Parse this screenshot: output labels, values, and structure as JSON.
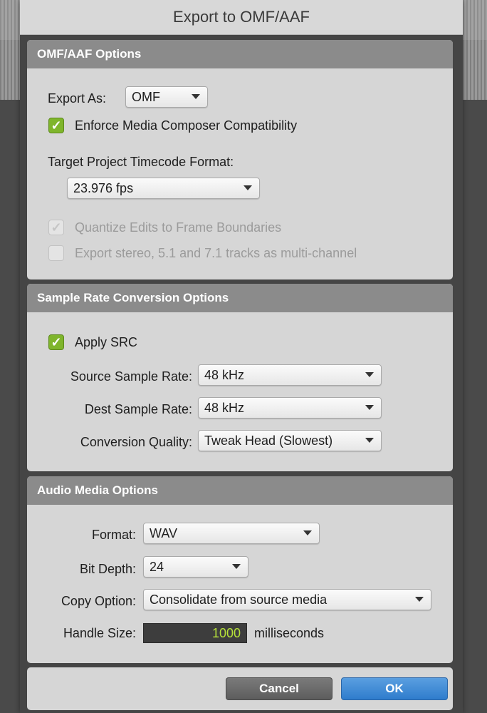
{
  "window": {
    "title": "Export to OMF/AAF"
  },
  "omf": {
    "header": "OMF/AAF Options",
    "export_as_label": "Export As:",
    "export_as_value": "OMF",
    "enforce_label": "Enforce Media Composer Compatibility",
    "enforce_checked": true,
    "timecode_label": "Target Project Timecode Format:",
    "timecode_value": "23.976 fps",
    "quantize_label": "Quantize Edits to Frame Boundaries",
    "quantize_checked": true,
    "quantize_enabled": false,
    "multichannel_label": "Export stereo, 5.1 and 7.1 tracks as multi-channel",
    "multichannel_checked": false,
    "multichannel_enabled": false
  },
  "src": {
    "header": "Sample Rate Conversion Options",
    "apply_label": "Apply SRC",
    "apply_checked": true,
    "source_label": "Source Sample Rate:",
    "source_value": "48 kHz",
    "dest_label": "Dest Sample Rate:",
    "dest_value": "48 kHz",
    "quality_label": "Conversion Quality:",
    "quality_value": "Tweak Head (Slowest)"
  },
  "audio": {
    "header": "Audio Media Options",
    "format_label": "Format:",
    "format_value": "WAV",
    "bitdepth_label": "Bit Depth:",
    "bitdepth_value": "24",
    "copy_label": "Copy Option:",
    "copy_value": "Consolidate from source media",
    "handle_label": "Handle Size:",
    "handle_value": "1000",
    "handle_unit": "milliseconds"
  },
  "buttons": {
    "cancel": "Cancel",
    "ok": "OK"
  },
  "colors": {
    "check_green": "#7fb52c",
    "ok_blue": "#3a86d4",
    "handle_text": "#b6e23a"
  },
  "icons": {
    "checkmark": "checkmark-icon",
    "popup_caret": "chevron-down-icon"
  }
}
